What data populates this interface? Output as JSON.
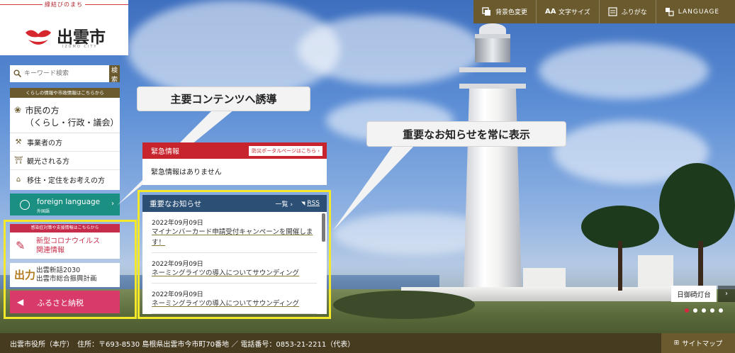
{
  "utility": {
    "items": [
      {
        "icon": "contrast-icon",
        "label": "背景色変更"
      },
      {
        "icon": "font-size-icon",
        "label": "文字サイズ"
      },
      {
        "icon": "ruby-icon",
        "label": "ふりがな"
      },
      {
        "icon": "language-icon",
        "label": "LANGUAGE"
      }
    ]
  },
  "logo": {
    "tagline": "縁結びのまち",
    "name": "出雲市",
    "sub": "IZUMO CITY"
  },
  "search": {
    "placeholder": "キーワード検索",
    "button": "検索"
  },
  "nav": {
    "header": "くらしの情報や市政情報はこちらから",
    "main_label": "市民の方",
    "main_sub": "（くらし・行政・議会）",
    "items": [
      {
        "label": "事業者の方"
      },
      {
        "label": "観光される方"
      },
      {
        "label": "移住・定住をお考えの方"
      }
    ]
  },
  "foreign": {
    "label": "foreign language",
    "sub": "外国語"
  },
  "covid": {
    "header": "感染症対策や支援情報はこちらから",
    "line1": "新型コロナウイルス",
    "line2": "関連情報"
  },
  "shinwa": {
    "logo": "出力",
    "line1": "出雲新話2030",
    "line2": "出雲市総合振興計画"
  },
  "furusato": {
    "label": "ふるさと納税"
  },
  "callouts": {
    "left": "主要コンテンツへ誘導",
    "right": "重要なお知らせを常に表示"
  },
  "emergency": {
    "title": "緊急情報",
    "link": "防災ポータルページはこちら",
    "body": "緊急情報はありません"
  },
  "news": {
    "title": "重要なお知らせ",
    "list_link": "一覧",
    "rss": "RSS",
    "items": [
      {
        "date": "2022年09月09日",
        "title": "マイナンバーカード申請受付キャンペーンを開催します！"
      },
      {
        "date": "2022年09月09日",
        "title": "ネーミングライツの導入についてサウンディング"
      },
      {
        "date": "2022年09月09日",
        "title": "ネーミングライツの導入についてサウンディング"
      }
    ]
  },
  "slide": {
    "caption": "日御碕灯台",
    "next": "›",
    "dots": 5,
    "active_index": 0
  },
  "footer": {
    "address": "出雲市役所（本庁）　住所：〒693-8530 島根県出雲市今市町70番地 ／ 電話番号：0853-21-2211（代表）",
    "sitemap": "サイトマップ"
  },
  "colors": {
    "brand": "#6a5a2e",
    "emergency": "#c8242d",
    "news_header": "#2c4f75",
    "foreign": "#1c8f83",
    "covid": "#c62d4a",
    "furusato": "#d83a6a",
    "highlight": "#f3e92a"
  }
}
